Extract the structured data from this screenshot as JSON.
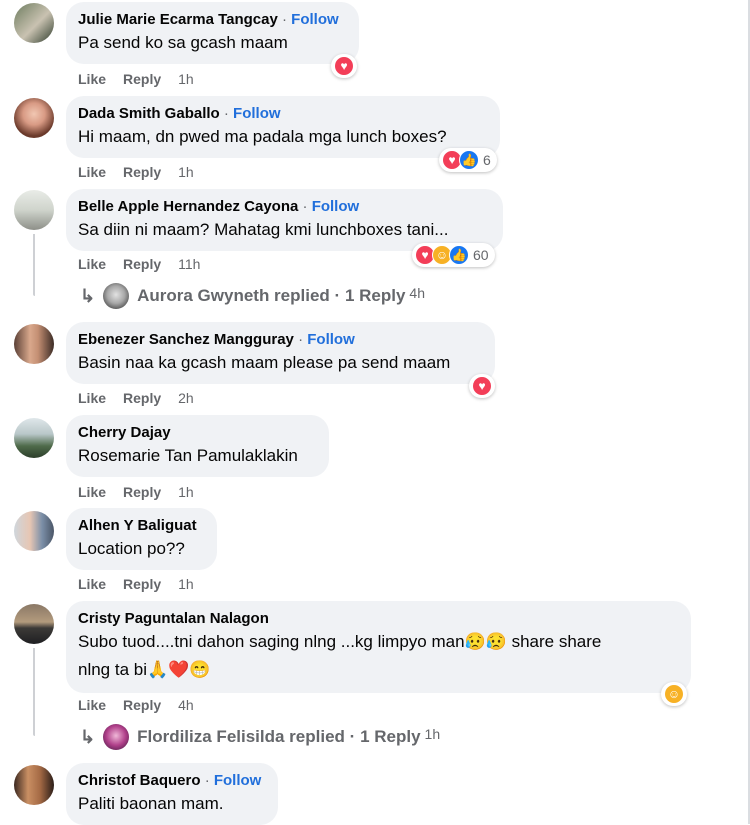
{
  "ui": {
    "follow": "Follow",
    "like": "Like",
    "reply": "Reply",
    "dot": "·"
  },
  "comments": [
    {
      "name": "Julie Marie Ecarma Tangcay",
      "text": "Pa send ko sa gcash maam",
      "time": "1h",
      "reactions": [
        "love"
      ],
      "count": ""
    },
    {
      "name": "Dada Smith Gaballo",
      "text": "Hi maam, dn pwed ma padala mga lunch boxes?",
      "time": "1h",
      "reactions": [
        "love",
        "like"
      ],
      "count": "6"
    },
    {
      "name": "Belle Apple Hernandez Cayona",
      "text": "Sa diin ni maam? Mahatag kmi lunchboxes tani...",
      "time": "11h",
      "reactions": [
        "love",
        "care",
        "like"
      ],
      "count": "60",
      "reply_summary": {
        "who": "Aurora Gwyneth replied",
        "dot": "·",
        "count": "1 Reply",
        "time": "4h"
      }
    },
    {
      "name": "Ebenezer Sanchez Mangguray",
      "text": "Basin naa ka gcash maam please pa send maam",
      "time": "2h",
      "reactions": [
        "love"
      ],
      "count": ""
    },
    {
      "name": "Cherry Dajay",
      "text": "Rosemarie Tan Pamulaklakin",
      "time": "1h"
    },
    {
      "name": "Alhen Y Baliguat",
      "text": "Location po??",
      "time": "1h"
    },
    {
      "name": "Cristy Paguntalan Nalagon",
      "text": "Subo tuod....tni dahon saging nlng ...kg limpyo man😥😥 share share",
      "text2": "nlng ta bi🙏❤️😁",
      "time": "4h",
      "reactions": [
        "care"
      ],
      "count": "",
      "reply_summary": {
        "who": "Flordiliza Felisilda replied",
        "dot": "·",
        "count": "1 Reply",
        "time": "1h"
      }
    },
    {
      "name": "Christof Baquero",
      "text": "Paliti baonan mam."
    }
  ],
  "icons": {
    "reply_arrow": "reply-arrow-icon",
    "love": "heart-reaction-icon",
    "like": "thumbs-up-reaction-icon",
    "care": "care-reaction-icon"
  },
  "colors": {
    "bubble": "#f0f2f5",
    "follow": "#216fdb",
    "meta": "#65676b",
    "love": "#f33e58",
    "like": "#1877f2",
    "care": "#f7b125"
  }
}
